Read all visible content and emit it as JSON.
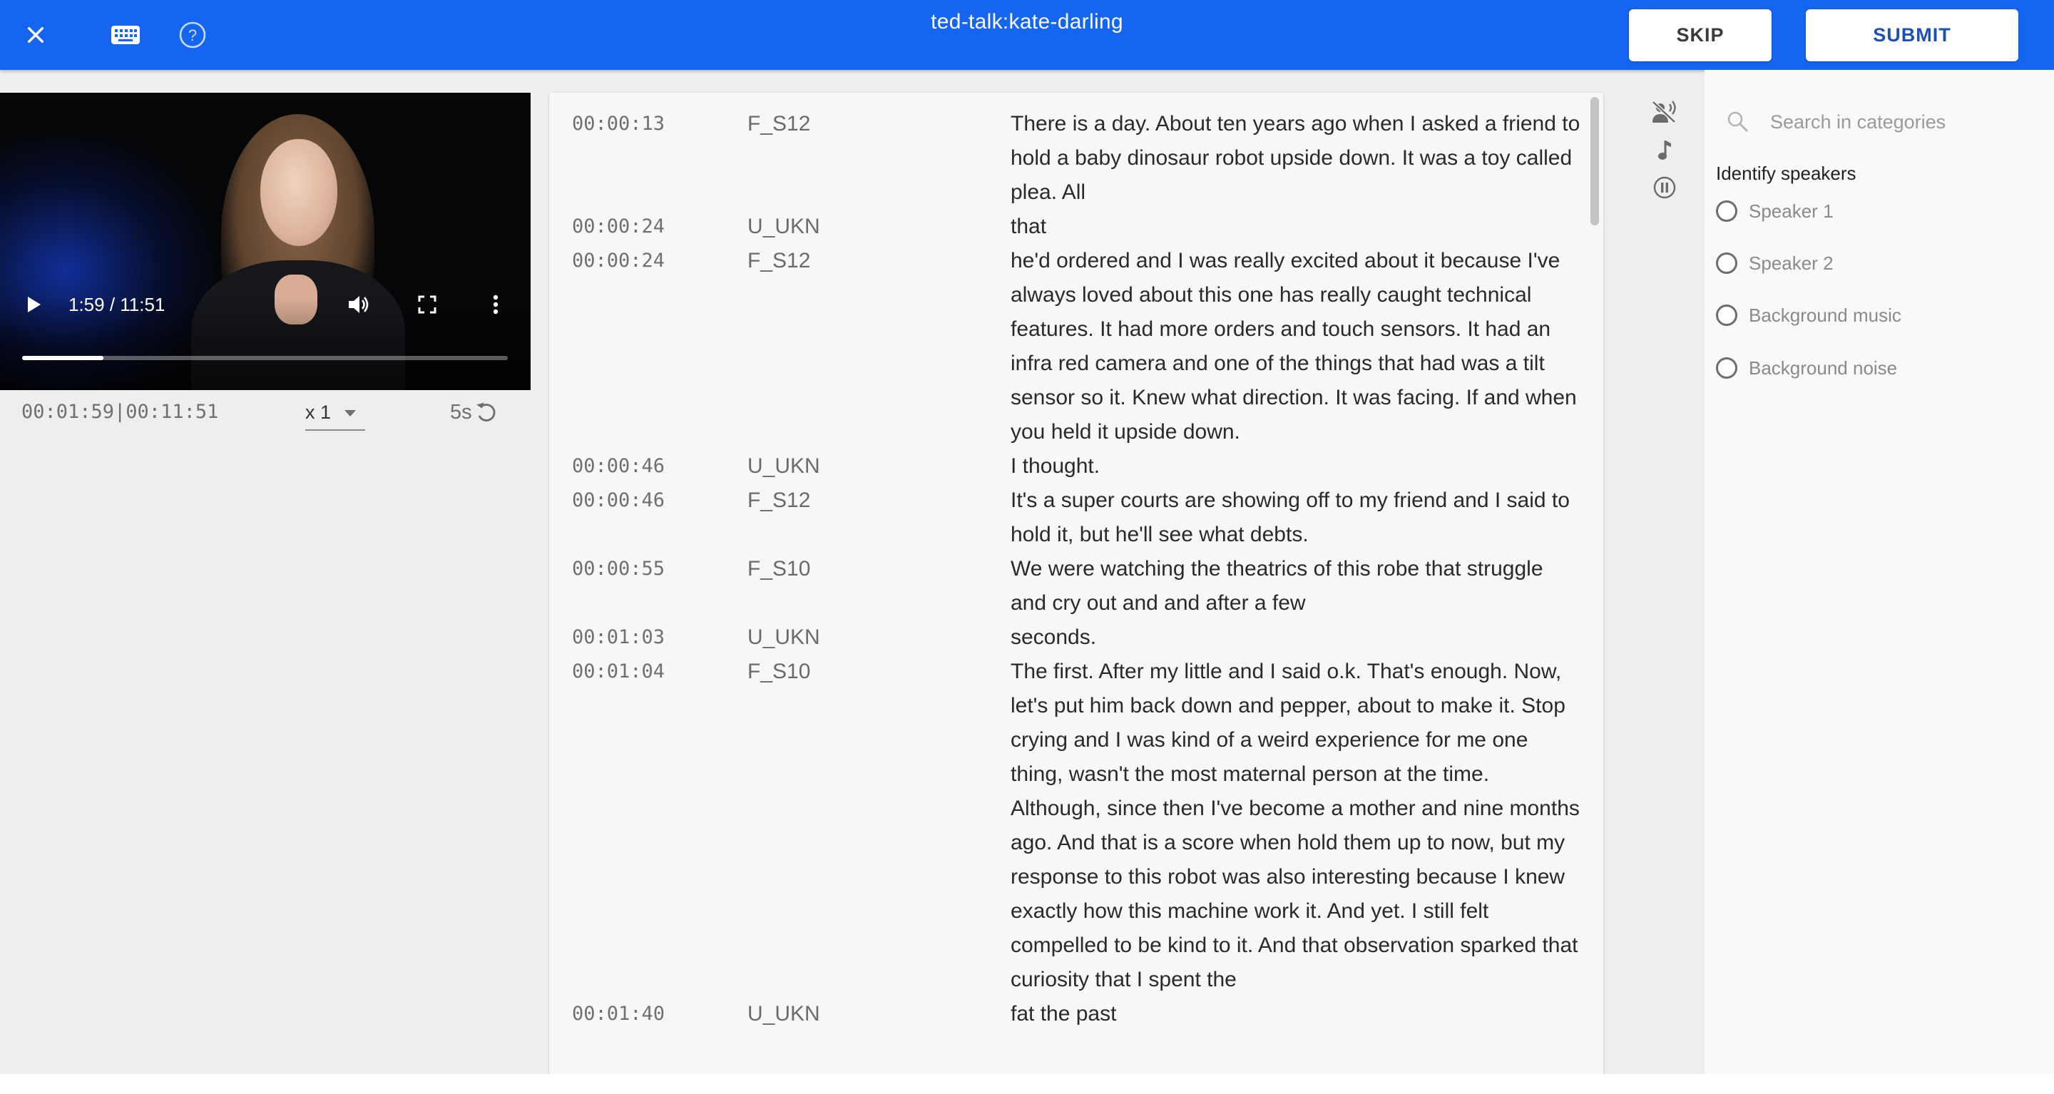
{
  "header": {
    "title": "ted-talk:kate-darling",
    "skip_label": "SKIP",
    "submit_label": "SUBMIT",
    "icons": [
      "close-icon",
      "keyboard-icon",
      "help-icon"
    ],
    "accent_color": "#1565f2"
  },
  "video": {
    "time_display": "1:59 / 11:51",
    "progress_fraction": 0.168,
    "timecode": "00:01:59|00:11:51",
    "speed": "x 1",
    "rewind_label": "5s"
  },
  "transcript": {
    "rows": [
      {
        "time": "00:00:13",
        "speaker": "F_S12",
        "text": "There is a day. About ten years ago when I asked a friend to hold a baby dinosaur robot upside down. It was a toy called plea. All"
      },
      {
        "time": "00:00:24",
        "speaker": "U_UKN",
        "text": "that"
      },
      {
        "time": "00:00:24",
        "speaker": "F_S12",
        "text": "he'd ordered and I was really excited about it because I've always loved about this one has really caught technical features. It had more orders and touch sensors. It had an infra red camera and one of the things that had was a tilt sensor so it. Knew what direction. It was facing. If and when you held it upside down."
      },
      {
        "time": "00:00:46",
        "speaker": "U_UKN",
        "text": "I thought."
      },
      {
        "time": "00:00:46",
        "speaker": "F_S12",
        "text": "It's a super courts are showing off to my friend and I said to hold it, but he'll see what debts."
      },
      {
        "time": "00:00:55",
        "speaker": "F_S10",
        "text": "We were watching the theatrics of this robe that struggle and cry out and and after a few"
      },
      {
        "time": "00:01:03",
        "speaker": "U_UKN",
        "text": "seconds."
      },
      {
        "time": "00:01:04",
        "speaker": "F_S10",
        "text": "The first. After my little and I said o.k. That's enough. Now, let's put him back down and pepper, about to make it. Stop crying and I was kind of a weird experience for me one thing, wasn't the most maternal person at the time. Although, since then I've become a mother and nine months ago. And that is a score when hold them up to now, but my response to this robot was also interesting because I knew exactly how this machine work it. And yet. I still felt compelled to be kind to it. And that observation sparked that curiosity that I spent the"
      },
      {
        "time": "00:01:40",
        "speaker": "U_UKN",
        "text": "fat the past"
      }
    ]
  },
  "tools": [
    "no-speech-icon",
    "music-note-icon",
    "pause-circle-icon"
  ],
  "categories": {
    "search_placeholder": "Search in categories",
    "section_title": "Identify speakers",
    "options": [
      {
        "label": "Speaker 1"
      },
      {
        "label": "Speaker 2"
      },
      {
        "label": "Background music"
      },
      {
        "label": "Background noise"
      }
    ]
  }
}
